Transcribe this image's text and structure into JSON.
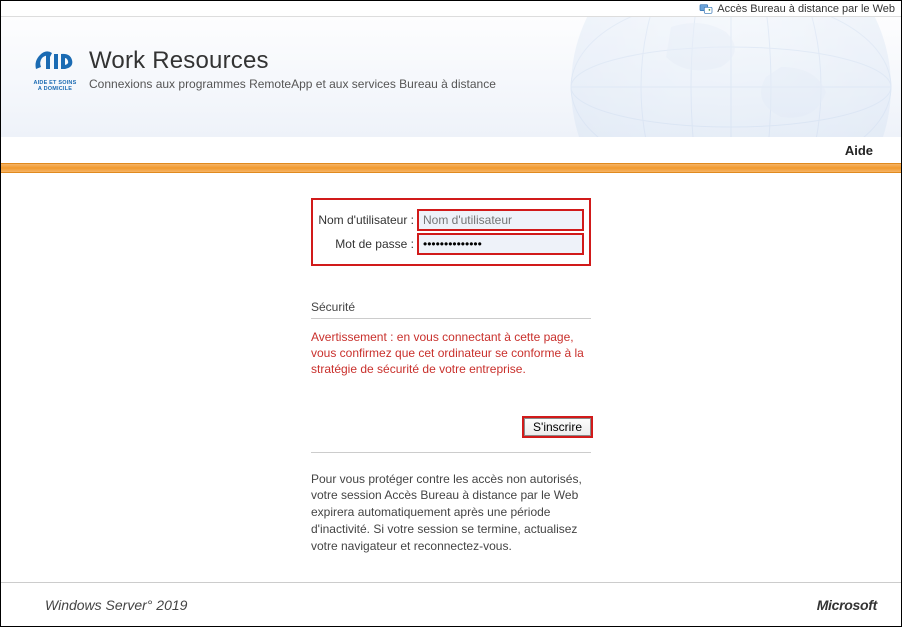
{
  "top_bar": {
    "label": "Accès Bureau à distance par le Web"
  },
  "header": {
    "logo_text": "AIDE ET SOINS A DOMICILE",
    "title": "Work Resources",
    "subtitle": "Connexions aux programmes RemoteApp et aux services Bureau à distance"
  },
  "nav": {
    "help": "Aide"
  },
  "form": {
    "username_label": "Nom d'utilisateur :",
    "username_placeholder": "Nom d'utilisateur",
    "username_value": "",
    "password_label": "Mot de passe :",
    "password_value": "••••••••••••••",
    "security_heading": "Sécurité",
    "warning": "Avertissement : en vous connectant à cette page, vous confirmez que cet ordinateur se conforme à la stratégie de sécurité de votre entreprise.",
    "submit_label": "S'inscrire",
    "info": "Pour vous protéger contre les accès non autorisés, votre session Accès Bureau à distance par le Web expirera automatiquement après une période d'inactivité. Si votre session se termine, actualisez votre navigateur et reconnectez-vous."
  },
  "footer": {
    "left": "Windows Server° 2019",
    "right": "Microsoft"
  }
}
